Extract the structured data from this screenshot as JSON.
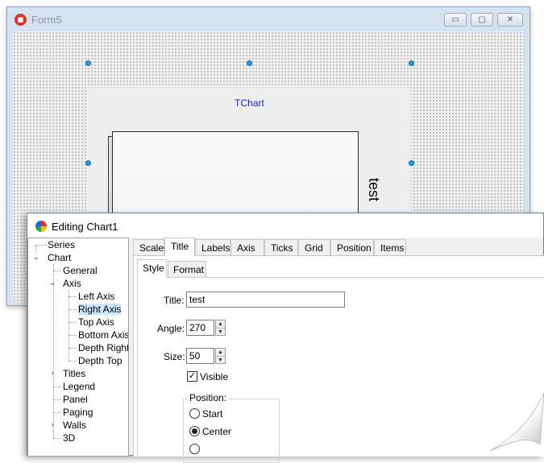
{
  "form5": {
    "title": "Form5",
    "controls": {
      "minimize": "▭",
      "maximize": "▢",
      "close": "✕"
    },
    "chart": {
      "title": "TChart",
      "axis_title": "test"
    }
  },
  "editor": {
    "title": "Editing Chart1",
    "tree": [
      {
        "label": "Series"
      },
      {
        "label": "Chart"
      },
      {
        "label": "General"
      },
      {
        "label": "Axis"
      },
      {
        "label": "Left Axis"
      },
      {
        "label": "Right Axis"
      },
      {
        "label": "Top Axis"
      },
      {
        "label": "Bottom Axis"
      },
      {
        "label": "Depth Right"
      },
      {
        "label": "Depth Top"
      },
      {
        "label": "Titles"
      },
      {
        "label": "Legend"
      },
      {
        "label": "Panel"
      },
      {
        "label": "Paging"
      },
      {
        "label": "Walls"
      },
      {
        "label": "3D"
      }
    ],
    "tabs": [
      "Scales",
      "Title",
      "Labels",
      "Axis",
      "Ticks",
      "Grid",
      "Position",
      "Items"
    ],
    "subtabs": [
      "Style",
      "Format"
    ],
    "form": {
      "title_label": "Title:",
      "title_value": "test",
      "angle_label": "Angle:",
      "angle_value": "270",
      "size_label": "Size:",
      "size_value": "50",
      "visible_label": "Visible",
      "visible_checked": true,
      "position_label": "Position:",
      "position_options": [
        "Start",
        "Center"
      ],
      "position_selected": "Center"
    }
  }
}
